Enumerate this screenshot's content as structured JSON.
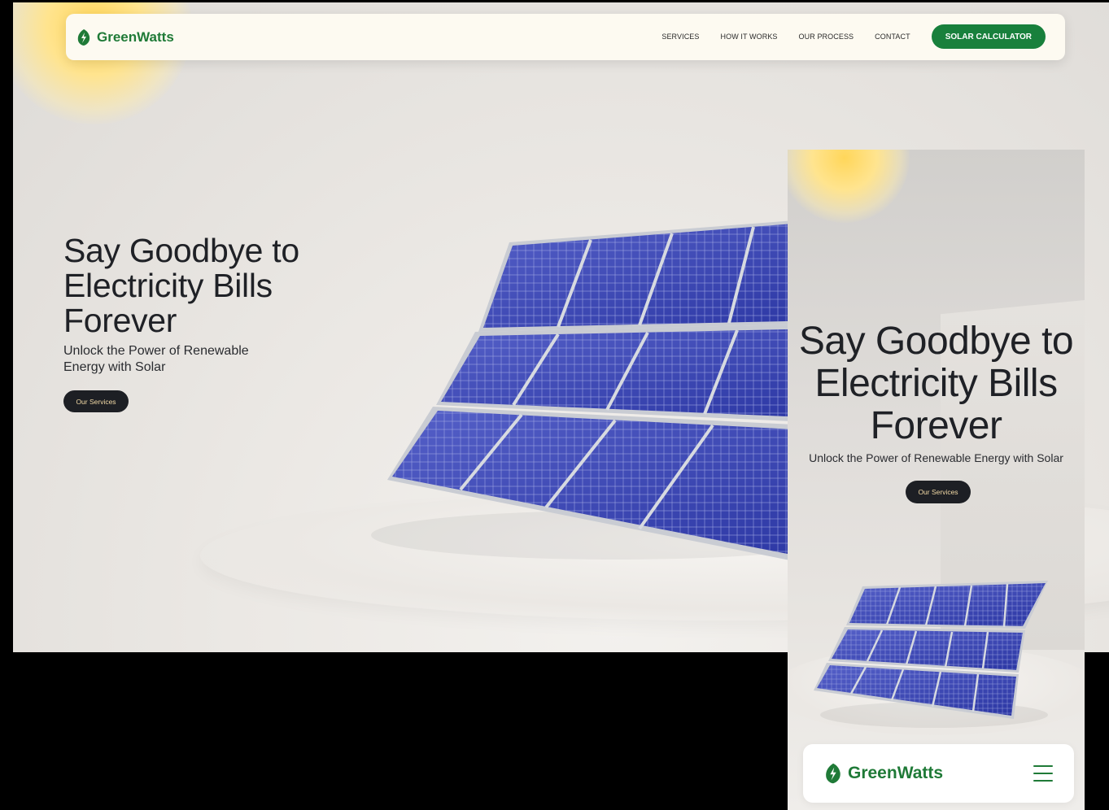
{
  "brand": {
    "name": "GreenWatts",
    "logo_icon": "leaf-bolt-icon",
    "color": "#1f7a37"
  },
  "desktop": {
    "nav": {
      "links": [
        "SERVICES",
        "HOW IT WORKS",
        "OUR PROCESS",
        "CONTACT"
      ],
      "cta": "SOLAR CALCULATOR"
    },
    "hero": {
      "title": "Say Goodbye to Electricity Bills Forever",
      "subtitle": "Unlock the Power of Renewable Energy with Solar",
      "button": "Our Services"
    }
  },
  "mobile": {
    "hero": {
      "title": "Say Goodbye to Electricity Bills Forever",
      "subtitle": "Unlock the Power of Renewable Energy with Solar",
      "button": "Our Services"
    },
    "nav": {
      "menu_icon": "hamburger-menu-icon"
    }
  },
  "colors": {
    "accent": "#18803c",
    "dark_button": "#1d1f24",
    "dark_button_text": "#f2d9a5",
    "panel_blue": "#3a46b5"
  }
}
